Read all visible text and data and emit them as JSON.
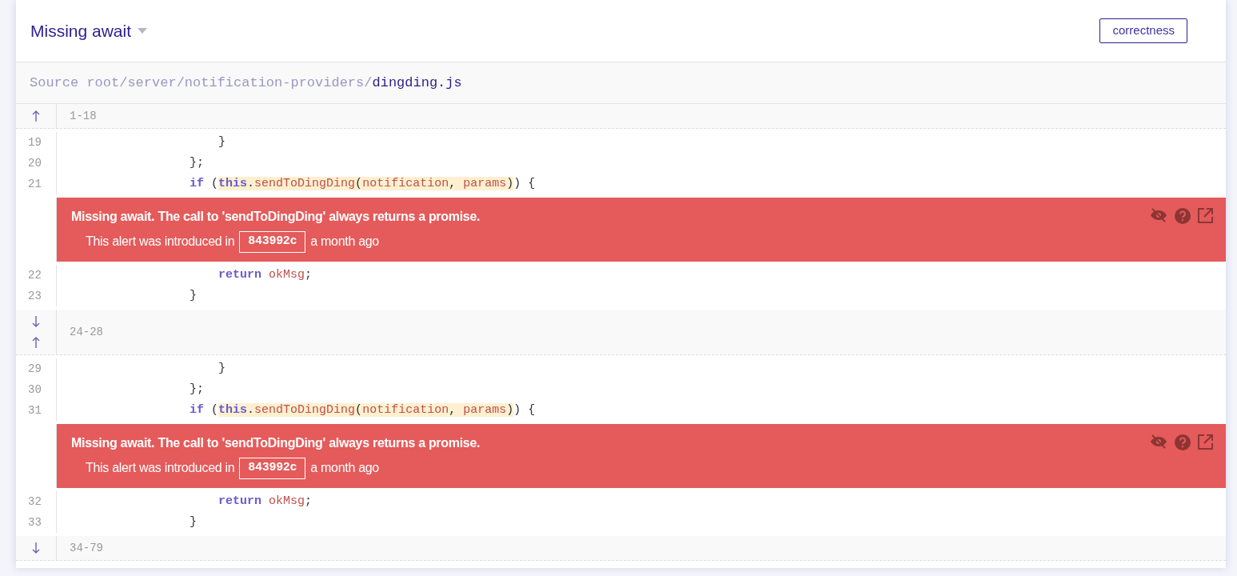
{
  "header": {
    "title": "Missing await",
    "tag": "correctness"
  },
  "source": {
    "prefix": "Source root/server/notification-providers/",
    "file": "dingding.js"
  },
  "blocks": [
    {
      "kind": "collapsed",
      "expand_up": true,
      "expand_down": false,
      "range": "1-18"
    },
    {
      "kind": "code",
      "lines": [
        {
          "number": "19",
          "parts": [
            {
              "highlighted": false,
              "tokens": [
                {
                  "kind": "plain",
                  "text": "                    }"
                }
              ]
            }
          ]
        },
        {
          "number": "20",
          "parts": [
            {
              "highlighted": false,
              "tokens": [
                {
                  "kind": "plain",
                  "text": "                };"
                }
              ]
            }
          ]
        },
        {
          "number": "21",
          "parts": [
            {
              "highlighted": false,
              "tokens": [
                {
                  "kind": "keyword",
                  "text": "                if"
                },
                {
                  "kind": "plain",
                  "text": " ("
                }
              ]
            },
            {
              "highlighted": true,
              "tokens": [
                {
                  "kind": "keyword",
                  "text": "this"
                },
                {
                  "kind": "plain",
                  "text": "."
                },
                {
                  "kind": "ident",
                  "text": "sendToDingDing"
                },
                {
                  "kind": "plain",
                  "text": "("
                },
                {
                  "kind": "ident",
                  "text": "notification"
                },
                {
                  "kind": "plain",
                  "text": ", "
                },
                {
                  "kind": "ident",
                  "text": "params"
                },
                {
                  "kind": "plain",
                  "text": ")"
                }
              ]
            },
            {
              "highlighted": false,
              "tokens": [
                {
                  "kind": "plain",
                  "text": ") {"
                }
              ]
            }
          ]
        }
      ]
    },
    {
      "kind": "alert",
      "message": "Missing await. The call to 'sendToDingDing' always returns a promise.",
      "intro": "This alert was introduced in",
      "commit": "843992c",
      "age": "a month ago"
    },
    {
      "kind": "code",
      "lines": [
        {
          "number": "22",
          "parts": [
            {
              "highlighted": false,
              "tokens": [
                {
                  "kind": "keyword",
                  "text": "                    return "
                },
                {
                  "kind": "ident",
                  "text": "okMsg"
                },
                {
                  "kind": "plain",
                  "text": ";"
                }
              ]
            }
          ]
        },
        {
          "number": "23",
          "parts": [
            {
              "highlighted": false,
              "tokens": [
                {
                  "kind": "plain",
                  "text": "                }"
                }
              ]
            }
          ]
        }
      ]
    },
    {
      "kind": "collapsed",
      "expand_up": true,
      "expand_down": true,
      "range": "24-28"
    },
    {
      "kind": "code",
      "lines": [
        {
          "number": "29",
          "parts": [
            {
              "highlighted": false,
              "tokens": [
                {
                  "kind": "plain",
                  "text": "                    }"
                }
              ]
            }
          ]
        },
        {
          "number": "30",
          "parts": [
            {
              "highlighted": false,
              "tokens": [
                {
                  "kind": "plain",
                  "text": "                };"
                }
              ]
            }
          ]
        },
        {
          "number": "31",
          "parts": [
            {
              "highlighted": false,
              "tokens": [
                {
                  "kind": "keyword",
                  "text": "                if"
                },
                {
                  "kind": "plain",
                  "text": " ("
                }
              ]
            },
            {
              "highlighted": true,
              "tokens": [
                {
                  "kind": "keyword",
                  "text": "this"
                },
                {
                  "kind": "plain",
                  "text": "."
                },
                {
                  "kind": "ident",
                  "text": "sendToDingDing"
                },
                {
                  "kind": "plain",
                  "text": "("
                },
                {
                  "kind": "ident",
                  "text": "notification"
                },
                {
                  "kind": "plain",
                  "text": ", "
                },
                {
                  "kind": "ident",
                  "text": "params"
                },
                {
                  "kind": "plain",
                  "text": ")"
                }
              ]
            },
            {
              "highlighted": false,
              "tokens": [
                {
                  "kind": "plain",
                  "text": ") {"
                }
              ]
            }
          ]
        }
      ]
    },
    {
      "kind": "alert",
      "message": "Missing await. The call to 'sendToDingDing' always returns a promise.",
      "intro": "This alert was introduced in",
      "commit": "843992c",
      "age": "a month ago"
    },
    {
      "kind": "code",
      "lines": [
        {
          "number": "32",
          "parts": [
            {
              "highlighted": false,
              "tokens": [
                {
                  "kind": "keyword",
                  "text": "                    return "
                },
                {
                  "kind": "ident",
                  "text": "okMsg"
                },
                {
                  "kind": "plain",
                  "text": ";"
                }
              ]
            }
          ]
        },
        {
          "number": "33",
          "parts": [
            {
              "highlighted": false,
              "tokens": [
                {
                  "kind": "plain",
                  "text": "                }"
                }
              ]
            }
          ]
        }
      ]
    },
    {
      "kind": "collapsed",
      "expand_up": false,
      "expand_down": true,
      "range": "34-79"
    }
  ]
}
